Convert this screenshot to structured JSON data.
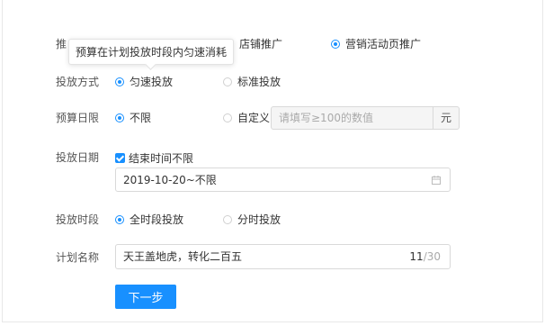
{
  "tooltip": {
    "text": "预算在计划投放时段内匀速消耗"
  },
  "promo": {
    "label": "推",
    "options": [
      {
        "label": "店铺推广",
        "checked": false
      },
      {
        "label": "营销活动页推广",
        "checked": true
      }
    ]
  },
  "delivery_mode": {
    "label": "投放方式",
    "options": [
      {
        "label": "匀速投放",
        "checked": true
      },
      {
        "label": "标准投放",
        "checked": false
      }
    ]
  },
  "budget": {
    "label": "预算日限",
    "options": [
      {
        "label": "不限",
        "checked": true
      },
      {
        "label": "自定义",
        "checked": false
      }
    ],
    "placeholder": "请填写≥100的数值",
    "unit": "元"
  },
  "dates": {
    "label": "投放日期",
    "checkbox_label": "结束时间不限",
    "value": "2019-10-20~不限",
    "icon": "calendar-icon"
  },
  "time_slot": {
    "label": "投放时段",
    "options": [
      {
        "label": "全时段投放",
        "checked": true
      },
      {
        "label": "分时投放",
        "checked": false
      }
    ]
  },
  "plan_name": {
    "label": "计划名称",
    "value": "天王盖地虎，转化二百五",
    "count_current": "11",
    "count_max": "/30"
  },
  "next_button": {
    "label": "下一步"
  },
  "colors": {
    "primary": "#1890ff",
    "border": "#d9d9d9",
    "disabled_bg": "#f5f5f5"
  }
}
